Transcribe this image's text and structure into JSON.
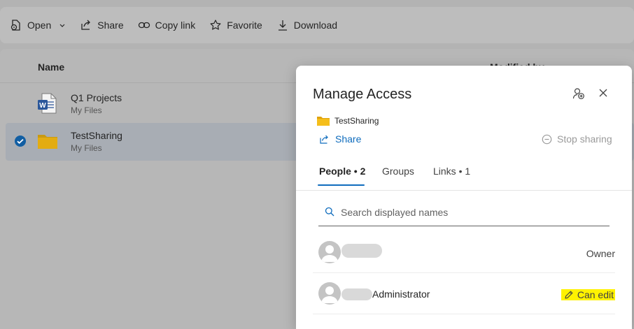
{
  "toolbar": {
    "items": [
      {
        "label": "Open",
        "icon": "open-file-icon"
      },
      {
        "label": "Share",
        "icon": "share-icon"
      },
      {
        "label": "Copy link",
        "icon": "link-icon"
      },
      {
        "label": "Favorite",
        "icon": "star-icon"
      },
      {
        "label": "Download",
        "icon": "download-icon"
      }
    ]
  },
  "file_list": {
    "columns": {
      "name": "Name",
      "modified_by": "Modified by"
    },
    "rows": [
      {
        "name": "Q1 Projects",
        "location": "My Files",
        "icon": "word-document-icon",
        "selected": false
      },
      {
        "name": "TestSharing",
        "location": "My Files",
        "icon": "folder-icon",
        "selected": true
      }
    ]
  },
  "panel": {
    "title": "Manage Access",
    "item_name": "TestSharing",
    "share_label": "Share",
    "stop_sharing_label": "Stop sharing",
    "tabs": [
      {
        "label": "People • 2",
        "active": true
      },
      {
        "label": "Groups",
        "active": false
      },
      {
        "label": "Links • 1",
        "active": false
      }
    ],
    "search_placeholder": "Search displayed names",
    "people": [
      {
        "name": "",
        "role": "Owner"
      },
      {
        "name": "Administrator",
        "role": "Can edit"
      }
    ]
  },
  "colors": {
    "accent": "#0f6cbd",
    "highlight": "#fff200",
    "folder": "#f2b90f"
  }
}
